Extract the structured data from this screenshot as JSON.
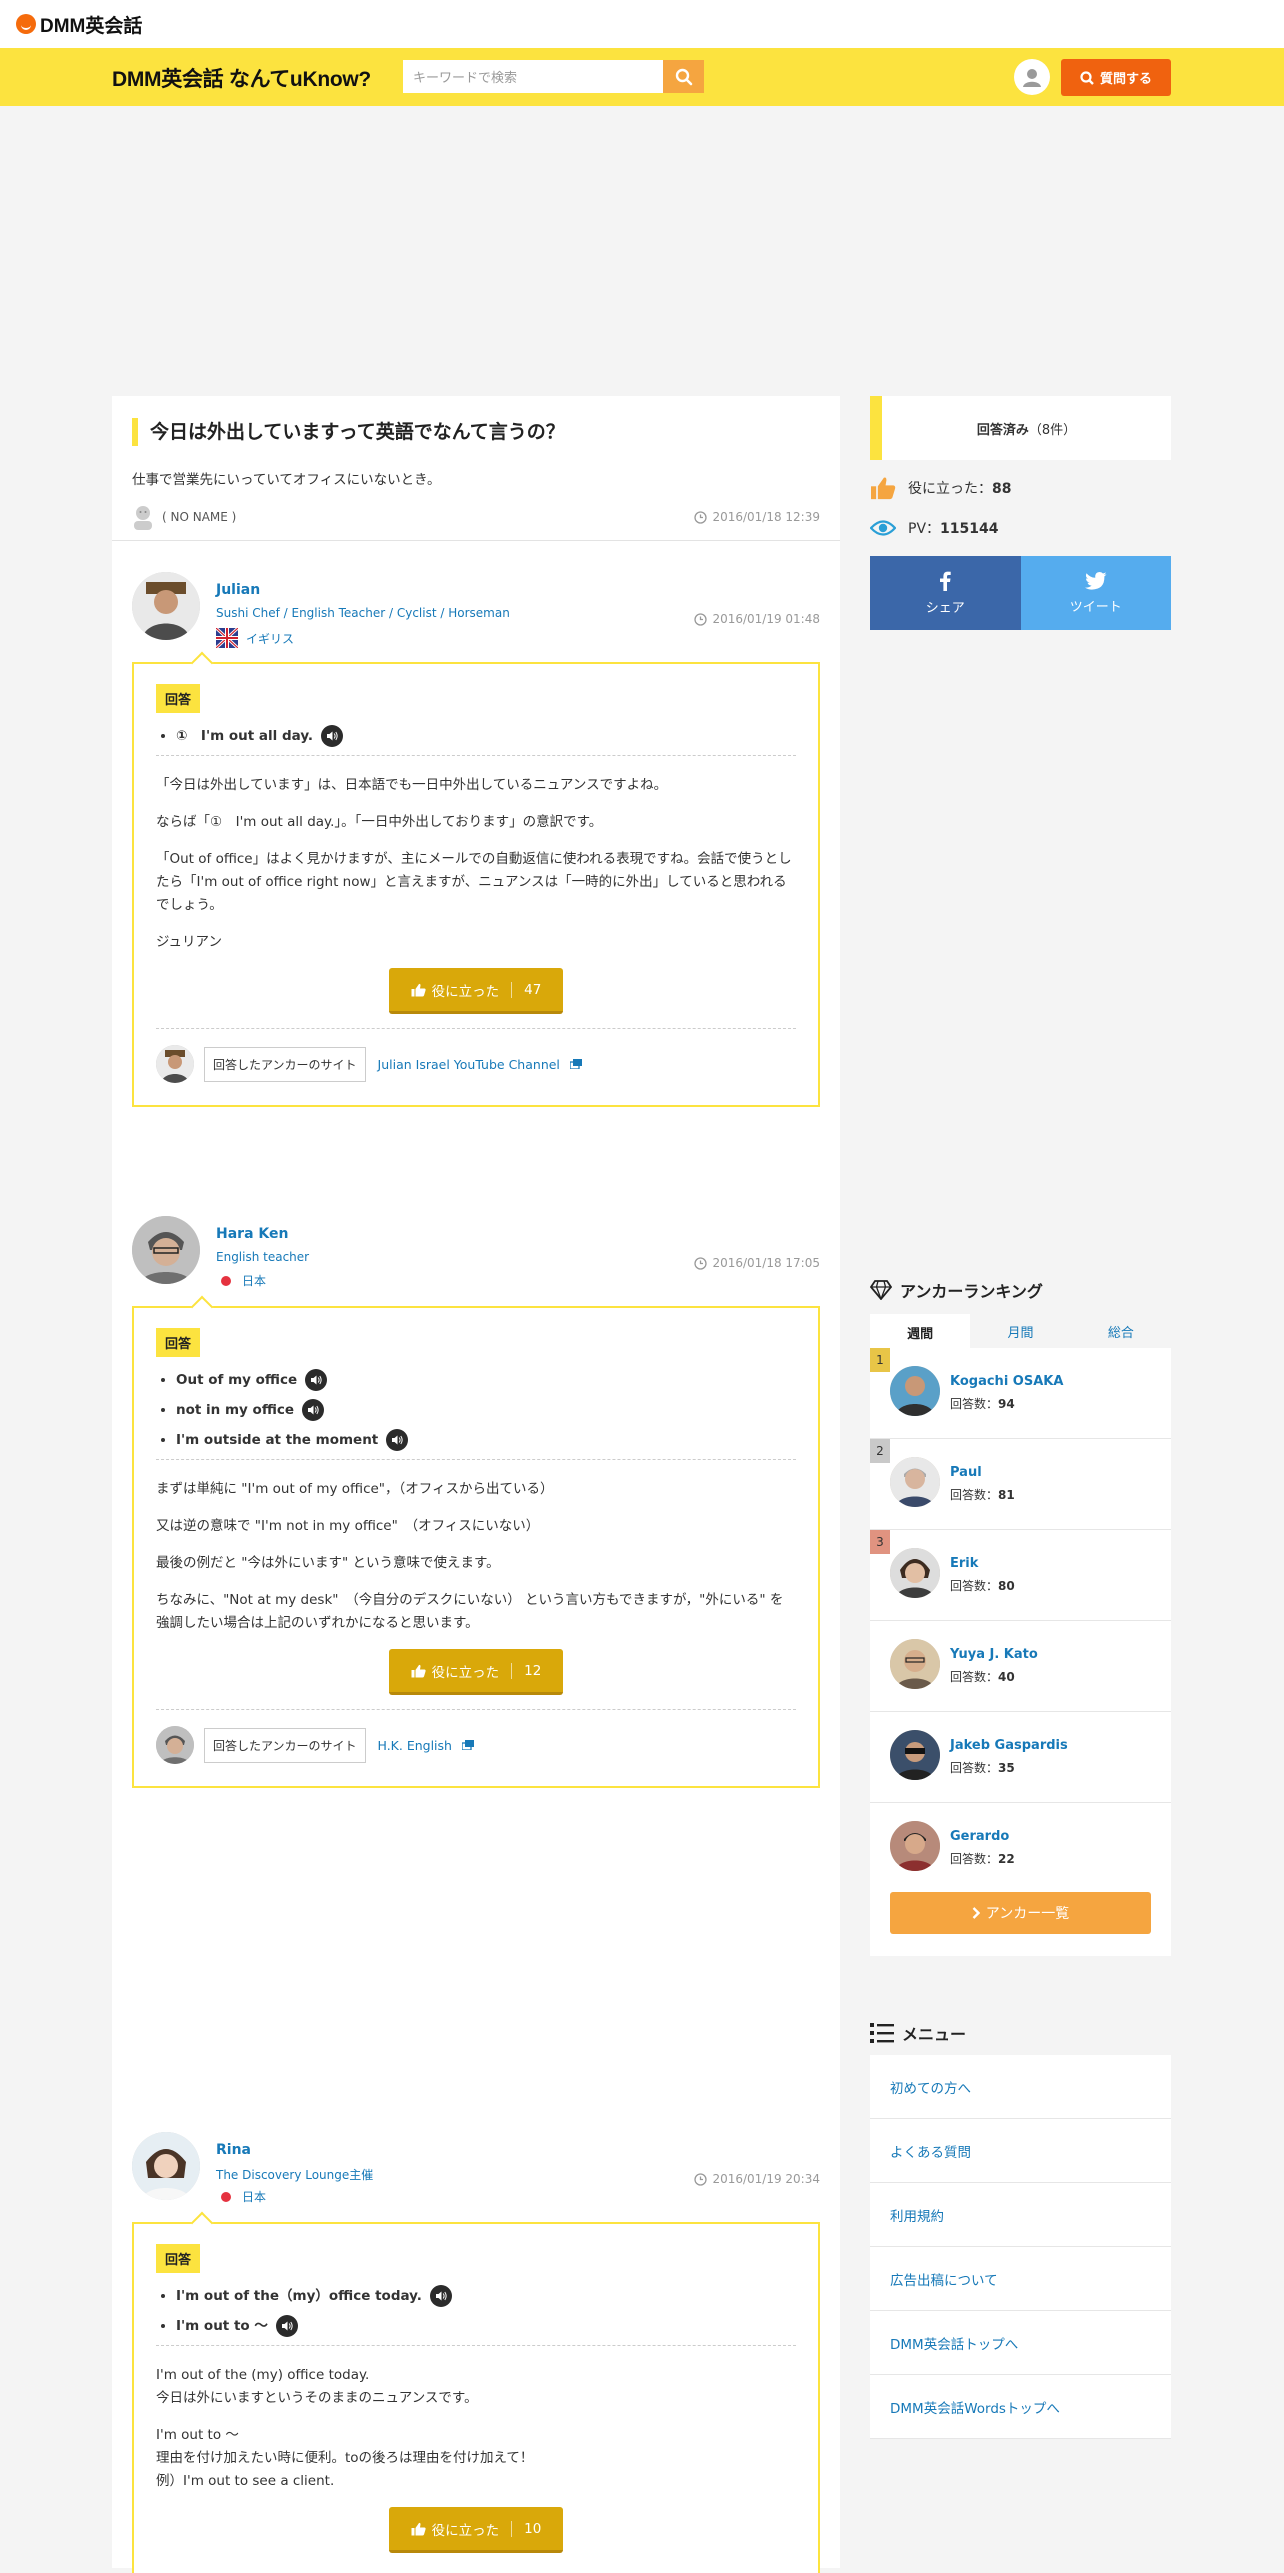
{
  "header": {
    "site_logo": "DMM英会話",
    "brand": "DMM英会話 なんてuKnow?",
    "search_placeholder": "キーワードで検索",
    "ask_button": "質問する"
  },
  "question": {
    "title": "今日は外出していますって英語でなんて言うの？",
    "body": "仕事で営業先にいっていてオフィスにいないとき。",
    "author": "( NO NAME )",
    "time": "2016/01/18 12:39"
  },
  "answers": [
    {
      "name": "Julian",
      "title": "Sushi Chef / English Teacher / Cyclist / Horseman",
      "country": "イギリス",
      "time": "2016/01/19 01:48",
      "badge": "回答",
      "phrases": [
        "①　I'm out all day."
      ],
      "paragraphs": [
        "「今日は外出しています」は、日本語でも一日中外出しているニュアンスですよね。",
        "ならば「①　I'm out all day.」。「一日中外出しております」の意訳です。",
        "「Out of office」はよく見かけますが、主にメールでの自動返信に使われる表現ですね。会話で使うとしたら「I'm out of office right now」と言えますが、ニュアンスは「一時的に外出」していると思われるでしょう。",
        "ジュリアン"
      ],
      "helpful_label": "役に立った",
      "helpful_count": "47",
      "anchor_label": "回答したアンカーのサイト",
      "anchor_link": "Julian Israel YouTube Channel"
    },
    {
      "name": "Hara Ken",
      "title": "English teacher",
      "country": "日本",
      "time": "2016/01/18 17:05",
      "badge": "回答",
      "phrases": [
        "Out of my office",
        "not in my office",
        "I'm outside at the moment"
      ],
      "paragraphs": [
        "まずは単純に \"I'm out of my office\"，（オフィスから出ている）",
        "又は逆の意味で \"I'm not in my office\"　（オフィスにいない）",
        "最後の例だと \"今は外にいます\" という意味で使えます。",
        "ちなみに、\"Not at my desk\"　（今自分のデスクにいない） という言い方もできますが，\"外にいる\" を強調したい場合は上記のいずれかになると思います。"
      ],
      "helpful_label": "役に立った",
      "helpful_count": "12",
      "anchor_label": "回答したアンカーのサイト",
      "anchor_link": "H.K. English"
    },
    {
      "name": "Rina",
      "title": "The Discovery Lounge主催",
      "country": "日本",
      "time": "2016/01/19 20:34",
      "badge": "回答",
      "phrases": [
        "I'm out of the（my）office today.",
        "I'm out to 〜"
      ],
      "para1_line1": "I'm out of the (my) office today.",
      "para1_line2": "今日は外にいますというそのままのニュアンスです。",
      "para2_line1": "I'm out to 〜",
      "para2_line2": "理由を付け加えたい時に便利。toの後ろは理由を付け加えて！",
      "para2_line3": "例）I'm out to see a client.",
      "helpful_label": "役に立った",
      "helpful_count": "10"
    }
  ],
  "sidebar": {
    "answered_label": "回答済み",
    "answered_count": "（8件）",
    "helpful_label": "役に立った：",
    "helpful_value": "88",
    "pv_label": "PV：",
    "pv_value": "115144",
    "share_label": "シェア",
    "tweet_label": "ツイート",
    "ranking_title": "アンカーランキング",
    "tabs": [
      "週間",
      "月間",
      "総合"
    ],
    "ranking": [
      {
        "rank": "1",
        "name": "Kogachi OSAKA",
        "count_label": "回答数：",
        "count": "94"
      },
      {
        "rank": "2",
        "name": "Paul",
        "count_label": "回答数：",
        "count": "81"
      },
      {
        "rank": "3",
        "name": "Erik",
        "count_label": "回答数：",
        "count": "80"
      },
      {
        "rank": "",
        "name": "Yuya J. Kato",
        "count_label": "回答数：",
        "count": "40"
      },
      {
        "rank": "",
        "name": "Jakeb Gaspardis",
        "count_label": "回答数：",
        "count": "35"
      },
      {
        "rank": "",
        "name": "Gerardo",
        "count_label": "回答数：",
        "count": "22"
      }
    ],
    "anchor_list_button": "アンカー一覧",
    "menu_title": "メニュー",
    "menu_items": [
      "初めての方へ",
      "よくある質問",
      "利用規約",
      "広告出稿について",
      "DMM英会話トップへ",
      "DMM英会話Wordsトップへ"
    ]
  },
  "colors": {
    "accent_yellow": "#fce33f",
    "ask_orange": "#f0620f",
    "link_blue": "#1779b8",
    "facebook": "#3b67a9",
    "twitter": "#55acee"
  }
}
